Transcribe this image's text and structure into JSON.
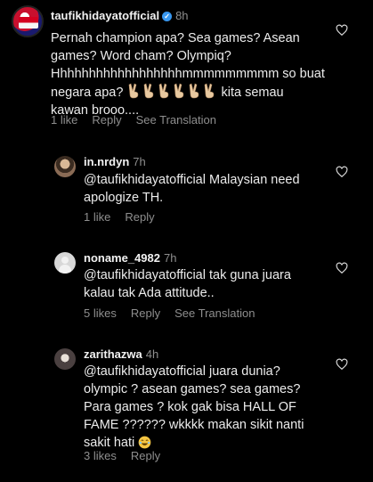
{
  "comments": [
    {
      "username": "taufikhidayatofficial",
      "verified": true,
      "time": "8h",
      "text_lines": [
        "Pernah champion apa? Sea games? Asean",
        "games? Word cham? Olympiq?",
        "Hhhhhhhhhhhhhhhhhhmmmmmmmmm so buat",
        "negara apa?",
        "kita semau",
        "kawan brooo...."
      ],
      "emoji": "victory-hand",
      "likes": "1 like",
      "reply": "Reply",
      "translate": "See Translation"
    },
    {
      "username": "in.nrdyn",
      "time": "7h",
      "text_lines": [
        "@taufikhidayatofficial Malaysian need",
        "apologize TH."
      ],
      "likes": "1 like",
      "reply": "Reply"
    },
    {
      "username": "noname_4982",
      "time": "7h",
      "text_lines": [
        "@taufikhidayatofficial tak guna juara",
        "kalau tak Ada attitude.."
      ],
      "likes": "5 likes",
      "reply": "Reply",
      "translate": "See Translation"
    },
    {
      "username": "zarithazwa",
      "time": "4h",
      "text_lines": [
        "@taufikhidayatofficial juara dunia?",
        "olympic ? asean games? sea games?",
        "Para games ? kok gak bisa HALL OF",
        "FAME ?????? wkkkk makan sikit nanti",
        "sakit hati"
      ],
      "emoji": "laughing-face",
      "likes": "3 likes",
      "reply": "Reply"
    }
  ],
  "colors": {
    "background": "#000000",
    "text": "#ececec",
    "muted": "#8e8e8e",
    "verified": "#3897f0"
  }
}
